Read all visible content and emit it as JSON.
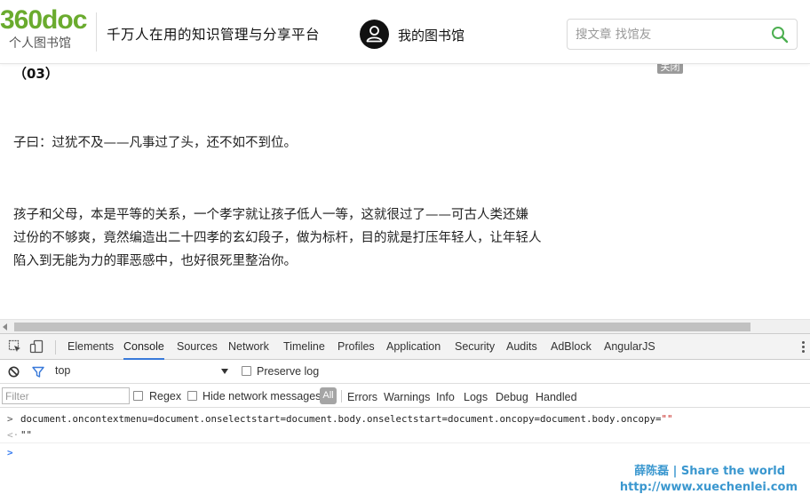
{
  "header": {
    "logo_main": "360doc",
    "logo_sub": "个人图书馆",
    "slogan": "千万人在用的知识管理与分享平台",
    "my_library": "我的图书馆",
    "search_placeholder": "搜文章 找馆友"
  },
  "article": {
    "heading": "（03）",
    "close_label": "关闭",
    "paragraph1": "子曰：过犹不及——凡事过了头，还不如不到位。",
    "paragraph2_lines": [
      "孩子和父母，本是平等的关系，一个孝字就让孩子低人一等，这就很过了——可古人类还嫌",
      "过份的不够爽，竟然编造出二十四孝的玄幻段子，做为标杆，目的就是打压年轻人，让年轻人",
      "陷入到无能为力的罪恶感中，也好很死里整治你。"
    ]
  },
  "devtools": {
    "tabs": [
      "Elements",
      "Console",
      "Sources",
      "Network",
      "Timeline",
      "Profiles",
      "Application",
      "Security",
      "Audits",
      "AdBlock",
      "AngularJS"
    ],
    "active_tab": "Console",
    "context": "top",
    "preserve_log": "Preserve log",
    "filter_placeholder": "Filter",
    "regex": "Regex",
    "hide_network": "Hide network messages",
    "all_label": "All",
    "levels": [
      "Errors",
      "Warnings",
      "Info",
      "Logs",
      "Debug",
      "Handled"
    ],
    "console": {
      "input_prompt": ">",
      "input_code": "document.oncontextmenu=document.onselectstart=document.body.onselectstart=document.oncopy=document.body.oncopy=",
      "input_string": "\"\"",
      "output_prompt": "<·",
      "output_value": "\"\"",
      "cursor_prompt": ">"
    }
  },
  "watermark": {
    "line1": "薛陈磊 | Share the world",
    "line2": "http://www.xuechenlei.com"
  },
  "colors": {
    "logo_green": "#6aab2e",
    "search_icon_green": "#4caf50",
    "active_tab_underline": "#3879d9",
    "watermark_blue": "#3a97cf",
    "string_red": "#c41a16"
  }
}
